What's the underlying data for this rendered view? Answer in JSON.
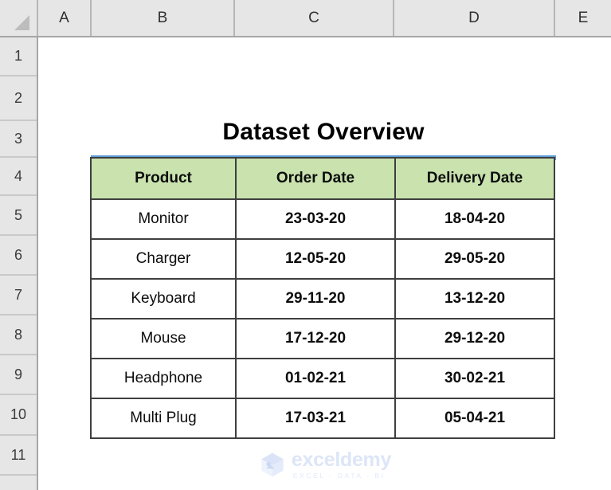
{
  "app": {
    "type": "spreadsheet",
    "select_all_icon": "select-all-triangle-icon"
  },
  "grid": {
    "column_headers": [
      "A",
      "B",
      "C",
      "D",
      "E"
    ],
    "row_headers": [
      "1",
      "2",
      "3",
      "4",
      "5",
      "6",
      "7",
      "8",
      "9",
      "10",
      "11"
    ]
  },
  "title": {
    "text": "Dataset Overview",
    "underline_color": "#5B9BD5"
  },
  "table": {
    "header_fill": "#C9E2AE",
    "border_color": "#3F3F3F",
    "columns": [
      "Product",
      "Order Date",
      "Delivery Date"
    ],
    "rows": [
      {
        "product": "Monitor",
        "order_date": "23-03-20",
        "delivery_date": "18-04-20"
      },
      {
        "product": "Charger",
        "order_date": "12-05-20",
        "delivery_date": "29-05-20"
      },
      {
        "product": "Keyboard",
        "order_date": "29-11-20",
        "delivery_date": "13-12-20"
      },
      {
        "product": "Mouse",
        "order_date": "17-12-20",
        "delivery_date": "29-12-20"
      },
      {
        "product": "Headphone",
        "order_date": "01-02-21",
        "delivery_date": "30-02-21"
      },
      {
        "product": "Multi Plug",
        "order_date": "17-03-21",
        "delivery_date": "05-04-21"
      }
    ]
  },
  "watermark": {
    "name": "exceldemy",
    "tagline": "EXCEL - DATA - BI",
    "logo_icon": "exceldemy-cube-logo-icon",
    "color": "#DDE6F7"
  }
}
